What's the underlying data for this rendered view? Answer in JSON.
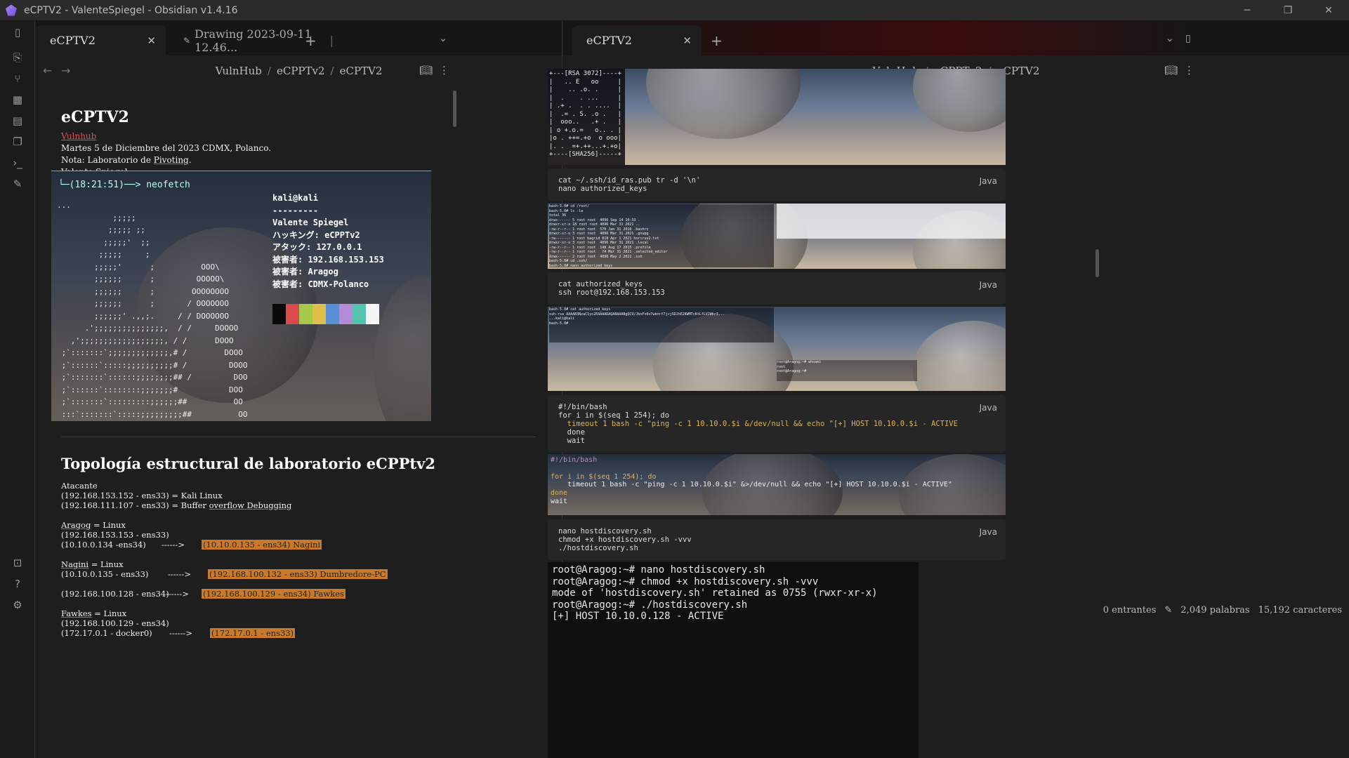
{
  "window": {
    "title": "eCPTV2 - ValenteSpiegel - Obsidian v1.4.16",
    "minimize": "─",
    "maximize": "❐",
    "close": "✕"
  },
  "left_pane": {
    "tabs": [
      {
        "label": "eCPTV2"
      },
      {
        "label": "Drawing 2023-09-11 12.46..."
      }
    ],
    "breadcrumb": [
      "VulnHub",
      "eCPPTv2",
      "eCPTV2"
    ],
    "doc_title": "eCPTV2",
    "meta": {
      "link": "Vulnhub",
      "line1": "Martes 5 de Diciembre del 2023 CDMX, Polanco.",
      "line2_prefix": "Nota: Laboratorio de ",
      "line2_link": "Pivoting",
      "line2_suffix": ".",
      "line3": "Valente Spiegel."
    },
    "neofetch": {
      "prompt": "└─(18:21:51)──> neofetch",
      "art": "...\n            ;;;;;\n           ;;;;; ;;\n          ;;;;;'  ;;\n         ;;;;;     ;\n        ;;;;;'      ;          OOO\\\n        ;;;;;;      ;         OOOOO\\\n        ;;;;;;      ;        OOOOOOOO\n        ;;;;;;      ;       / OOOOOOO\n        ;;;;;;' .,,;.     / / DOOOOOO\n      .';;;;;;;;;;;;;;;,  / /     DOOOO\n   ,';;;;;;;;;;;;;;;;;;, / /      DOOO\n ;`:::::::`;;;;;;;;;;;;;,# /        DOOO\n ;`::::::`:::::;;;;;;;;;;# /         DOOO\n ;`:::::::`::::::;;;;;;;;## /         DOO\n ;`::::::`::::::::;;;;;;;#           DOO\n ;`:::::::`:::::::::;;;;;;##          OO\n :::`:::::::`:::::;;;;;;;;;##          OO\n ::::::`::::::`::::;;;;;;;;;#           O\n  `::::::`:::::::::;;;;;;;;:#\n   `:::::`::::::::;;;;;;;;/ / `:#\n    `:::::`:::::;;;;' / /    `#%",
      "info": "kali@kali\n---------\nValente Spiegel\nハッキング: eCPPTv2\nアタック: 127.0.0.1\n被害者: 192.168.153.153\n被害者: Aragog\n被害者: CDMX-Polanco",
      "palette": [
        "#0a0a0a",
        "#d94a4a",
        "#a7c94b",
        "#e0c04a",
        "#5a8ed6",
        "#b58ad6",
        "#58c2b0",
        "#f5f5f5"
      ]
    },
    "topo_title": "Topología estructural de laboratorio eCPPtv2",
    "topo": {
      "atacante_h": "Atacante",
      "atacante_1": "(192.168.153.152 - ens33) = Kali Linux",
      "atacante_2_a": "(192.168.111.107 - ens33) = Buffer ",
      "atacante_2_b": "overflow Debugging",
      "aragog_h_a": "Aragog",
      "aragog_h_b": " = Linux",
      "aragog_1": "(192.168.153.153 - ens33)",
      "aragog_2": "(10.10.0.134 -ens34)",
      "aragog_arrow": "------>",
      "aragog_hl": "(10.10.0.135 - ens34)  Nagini",
      "nagini_h_a": "Nagini",
      "nagini_h_b": " = Linux",
      "nagini_1": "(10.10.0.135 - ens33)",
      "nagini_arrow1": "------>",
      "nagini_hl1": "(192.168.100.132 - ens33) Dumbredore-PC",
      "nagini_2": "(192.168.100.128 - ens34)",
      "nagini_arrow2": "------>",
      "nagini_hl2": "(192.168.100.129 - ens34) Fawkes",
      "fawkes_h_a": "Fawkes",
      "fawkes_h_b": " = Linux",
      "fawkes_1": "(192.168.100.129 - ens34)",
      "fawkes_2": "(172.17.0.1 - docker0)",
      "fawkes_arrow": "------>",
      "fawkes_hl": "(172.17.0.1 - ens33)"
    }
  },
  "right_pane": {
    "tabs": [
      {
        "label": "eCPTV2"
      }
    ],
    "breadcrumb": [
      "VulnHub",
      "eCPPTv2",
      "eCPTV2"
    ],
    "rsa_art": "+---[RSA 3072]----+\n|   .. E   oo     |\n|    .. .o. .     |\n|  .    . ...     |\n| .+ .  . . ....  |\n|  .= . S. .o .   |\n|  ooo..   .+ .   |\n| o +.o.=   o.. . |\n|o . ++=.+o  o ooo|\n|. .  =+.++...+.+o|\n+----[SHA256]-----+",
    "code_lang": "Java",
    "code1": [
      "cat ~/.ssh/id_ras.pub tr -d '\\n'",
      "nano authorized_keys"
    ],
    "code2": [
      "cat authorized_keys",
      "ssh root@192.168.153.153"
    ],
    "code3": [
      "#!/bin/bash",
      "for i in $(seq 1 254); do",
      "  timeout 1 bash -c \"ping -c 1 10.10.0.$i &/dev/null && echo \"[+] HOST 10.10.0.$i - ACTIVE",
      "  done",
      "  wait"
    ],
    "script_img": [
      "#!/bin/bash",
      "",
      "for i in $(seq 1 254); do",
      "    timeout 1 bash -c \"ping -c 1 10.10.0.$i\" &>/dev/null && echo \"[+] HOST 10.10.0.$i - ACTIVE\"",
      "done",
      "wait"
    ],
    "code4": [
      "nano hostdiscovery.sh",
      "chmod +x hostdiscovery.sh -vvv",
      "./hostdiscovery.sh"
    ],
    "big_term": "root@Aragog:~# nano hostdiscovery.sh\nroot@Aragog:~# chmod +x hostdiscovery.sh -vvv\nmode of 'hostdiscovery.sh' retained as 0755 (rwxr-xr-x)\nroot@Aragog:~# ./hostdiscovery.sh\n[+] HOST 10.10.0.128 - ACTIVE",
    "term_small_1": "bash-5.0# cd /root/\nbash-5.0# ls -la\ntotal 36\ndrwx------ 5 root root  4096 Sep 14 10:33 .\ndrwxr-xr-x 18 root root 4096 Mar 31 2021 ..\n-rw-r--r-- 1 root root  570 Jan 31 2010 .bashrc\ndrwxr-xr-x 3 root root  4096 Mar 31 2021 .gnupg\n-rw------- 1 root bagrid 818 Apr 1 2021 horcrux2.txt\ndrwxr-xr-x 3 root root  4096 Mar 31 2021 .local\n-rw-r--r-- 1 root root  148 Aug 17 2015 .profile\n-rw-r--r-- 1 root root   74 Mar 31 2021 .selected_editor\ndrwx------ 2 root root  4096 May 2 2021 .ssh\nbash-5.0# cd .ssh/\nbash-5.0# nano authorized_keys\nbash-5.0#",
    "term_small_2": "bash-5.0# cat authorized_keys\nssh-rsa AAAAB3NzaC1yc2EAAAADAQABAAABgQC9/JbxFx6v7wknrf7j+jSDJhE2KWMTcKtLfLV2Wbr3...\n...kali@kali\nbash-5.0#",
    "term_small_3": "root@Aragog:~# whoami\nroot\nroot@Aragog:~#",
    "status": {
      "backlinks": "0 entrantes",
      "words": "2,049 palabras",
      "chars": "15,192 caracteres"
    }
  }
}
